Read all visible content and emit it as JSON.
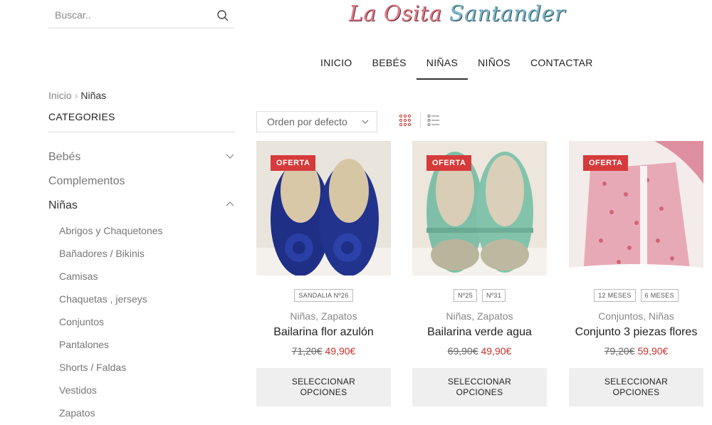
{
  "search": {
    "placeholder": "Buscar.."
  },
  "header": {
    "logo_part1": "La Osita",
    "logo_part2": "Santander",
    "nav": [
      {
        "label": "INICIO",
        "active": false
      },
      {
        "label": "BEBÉS",
        "active": false
      },
      {
        "label": "NIÑAS",
        "active": true
      },
      {
        "label": "NIÑOS",
        "active": false
      },
      {
        "label": "CONTACTAR",
        "active": false
      }
    ]
  },
  "breadcrumb": {
    "home": "Inicio",
    "separator": "›",
    "current": "Niñas"
  },
  "sidebar": {
    "title": "CATEGORIES",
    "categories": [
      {
        "label": "Bebés",
        "expanded": false
      },
      {
        "label": "Complementos"
      },
      {
        "label": "Niñas",
        "expanded": true
      }
    ],
    "subcategories": [
      "Abrigos y Chaquetones",
      "Bañadores / Bikinis",
      "Camisas",
      "Chaquetas , jerseys",
      "Conjuntos",
      "Pantalones",
      "Shorts / Faldas",
      "Vestidos",
      "Zapatos"
    ]
  },
  "toolbar": {
    "sort_label": "Orden por defecto"
  },
  "products": [
    {
      "badge": "OFERTA",
      "tags": [
        "SANDALIA Nº26"
      ],
      "categories": "Niñas, Zapatos",
      "name": "Bailarina flor azulón",
      "old_price": "71,20€",
      "new_price": "49,90€",
      "button_line1": "SELECCIONAR",
      "button_line2": "OPCIONES",
      "image": "blue-flower-shoes-photo"
    },
    {
      "badge": "OFERTA",
      "tags": [
        "Nº25",
        "Nº31"
      ],
      "categories": "Niñas, Zapatos",
      "name": "Bailarina verde agua",
      "old_price": "69,90€",
      "new_price": "49,90€",
      "button_line1": "SELECCIONAR",
      "button_line2": "OPCIONES",
      "image": "mint-green-shoes-photo"
    },
    {
      "badge": "OFERTA",
      "tags": [
        "12 MESES",
        "6 MESES"
      ],
      "categories": "Conjuntos, Niñas",
      "name": "Conjunto 3 piezas flores",
      "old_price": "79,20€",
      "new_price": "59,90€",
      "button_line1": "SELECCIONAR",
      "button_line2": "OPCIONES",
      "image": "floral-dress-set-photo"
    }
  ],
  "colors": {
    "sale_red": "#d63a3a",
    "price_red": "#c9302c",
    "button_bg": "#efefef",
    "view_grid_active": "#c9302c"
  }
}
